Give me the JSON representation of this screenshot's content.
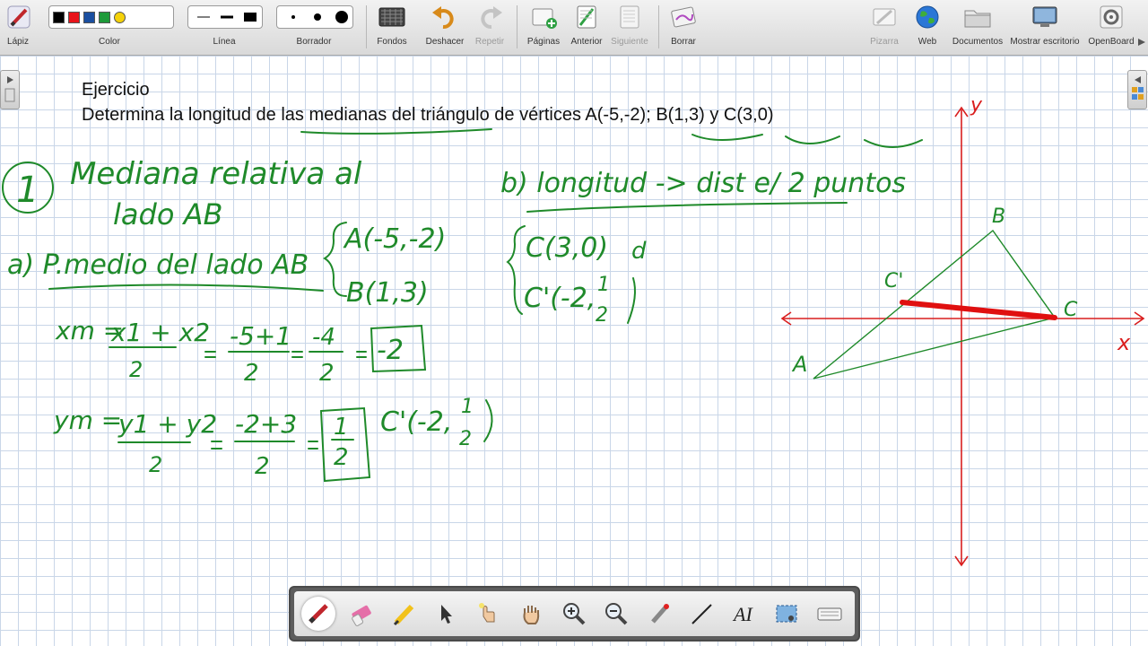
{
  "toolbar": {
    "pencil": "Lápiz",
    "color": "Color",
    "line": "Línea",
    "eraser": "Borrador",
    "backgrounds": "Fondos",
    "undo": "Deshacer",
    "redo": "Repetir",
    "pages": "Páginas",
    "previous": "Anterior",
    "next": "Siguiente",
    "erase": "Borrar",
    "whiteboard": "Pizarra",
    "web": "Web",
    "documents": "Documentos",
    "show_desktop": "Mostrar escritorio",
    "openboard": "OpenBoard",
    "colors": [
      "#000000",
      "#e8141b",
      "#1b4fa0",
      "#1f9a3a",
      "#f5d20a"
    ]
  },
  "board": {
    "title": "Ejercicio",
    "statement": "Determina la longitud de las medianas del triángulo de vértices A(-5,-2); B(1,3) y C(3,0)",
    "handwriting": {
      "step_number": "1",
      "heading_line1": "Mediana relativa al",
      "heading_line2": "lado AB",
      "part_a": "a) P.medio del lado AB",
      "point_a": "A(-5,-2)",
      "point_b": "B(1,3)",
      "xm_lhs": "xm =",
      "xm_num": "x1 + x2",
      "xm_den": "2",
      "xm_step1_num": "-5+1",
      "xm_step1_den": "2",
      "xm_step2_num": "-4",
      "xm_step2_den": "2",
      "xm_result": "-2",
      "ym_lhs": "ym =",
      "ym_num": "y1 + y2",
      "ym_den": "2",
      "ym_step1_num": "-2+3",
      "ym_step1_den": "2",
      "ym_result_num": "1",
      "ym_result_den": "2",
      "c_prime_1": "C'(-2,",
      "c_prime_1_num": "1",
      "c_prime_1_den": "2",
      "part_b": "b) longitud -> dist e/ 2 puntos",
      "point_c": "C(3,0)",
      "d_label": "d",
      "c_prime_2": "C'(-2,",
      "c_prime_2_num": "1",
      "c_prime_2_den": "2"
    },
    "graph": {
      "label_y": "y",
      "label_x": "x",
      "label_A": "A",
      "label_B": "B",
      "label_C": "C",
      "label_C_prime": "C'"
    }
  },
  "colors": {
    "ink_green": "#1f8a2a",
    "median_red": "#e01010",
    "axis_red": "#d91e1e"
  }
}
